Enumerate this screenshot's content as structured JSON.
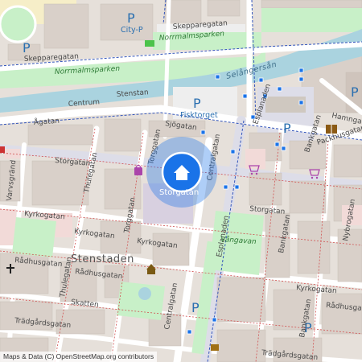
{
  "map": {
    "center_marker": {
      "label": "Storgatan",
      "icon": "home-icon",
      "color": "#1a73e8"
    },
    "districts": {
      "stenstaden": "Stenstaden"
    },
    "water": {
      "river": "Selångersån"
    },
    "pois": {
      "city_p": "City-P",
      "fisktorget": "Fisktorget",
      "parking_symbol": "P"
    },
    "parks": {
      "norrmalmsparken_north": "Norrmalmsparken",
      "norrmalmsparken_south": "Norrmalmsparken",
      "vangavan": "Vångavan"
    },
    "streets": {
      "skepparegatan_left": "Skepparegatan",
      "skepparegatan_right": "Skepparegatan",
      "centrum": "Centrum",
      "stenstan": "Stenstan",
      "agatan": "Ågatan",
      "sjogatan": "Sjögatan",
      "hamngatan": "Hamngat",
      "bankgatan_north": "Bankgatan",
      "packhusgatan": "Packhusgatan",
      "esplanaden_north": "Esplanaden",
      "esplanaden_south": "Esplanaden",
      "storgatan_west": "Storgatan",
      "storgatan_east": "Storgatan",
      "torggatan_north": "Torggatan",
      "torggatan_south": "Torggatan",
      "centralgatan_north": "Centralgatan",
      "centralgatan_south": "Centralgatan",
      "thulegatan_north": "Thulegatan",
      "thulegatan_south": "Thulegatan",
      "varvsgrand": "Varvsgränd",
      "kyrkogatan_west": "Kyrkogatan",
      "kyrkogatan_mid": "Kyrkogatan",
      "kyrkogatan_center": "Kyrkogatan",
      "kyrkogatan_east": "Kyrkogatan",
      "radhusgatan_west": "Rådhusgatan",
      "radhusgatan_mid": "Rådhusgatan",
      "radhusgatan_east": "Rådhusgatan",
      "bankgatan_mid": "Bankgatan",
      "bankgatan_south": "Bankgatan",
      "nybrogatan": "Nybrogatan",
      "skatten": "Skatten",
      "tradgardsgatan_west": "Trädgårdsgatan",
      "tradgardsgatan_east": "Trädgårdsgatan"
    },
    "attribution": "Maps & Data (C) OpenStreetMap.org contributors"
  },
  "colors": {
    "background": "#e6e0da",
    "building": "#d9d0c9",
    "building_pink": "#f2dad8",
    "park": "#c8f0c8",
    "water": "#aad3df",
    "road_major": "#ffffff",
    "road_pedestrian": "#dddde8",
    "bus_route": "#3355bb",
    "rail_red": "#d05050",
    "poi_blue": "#2a6fb0",
    "marker": "#1a73e8"
  }
}
